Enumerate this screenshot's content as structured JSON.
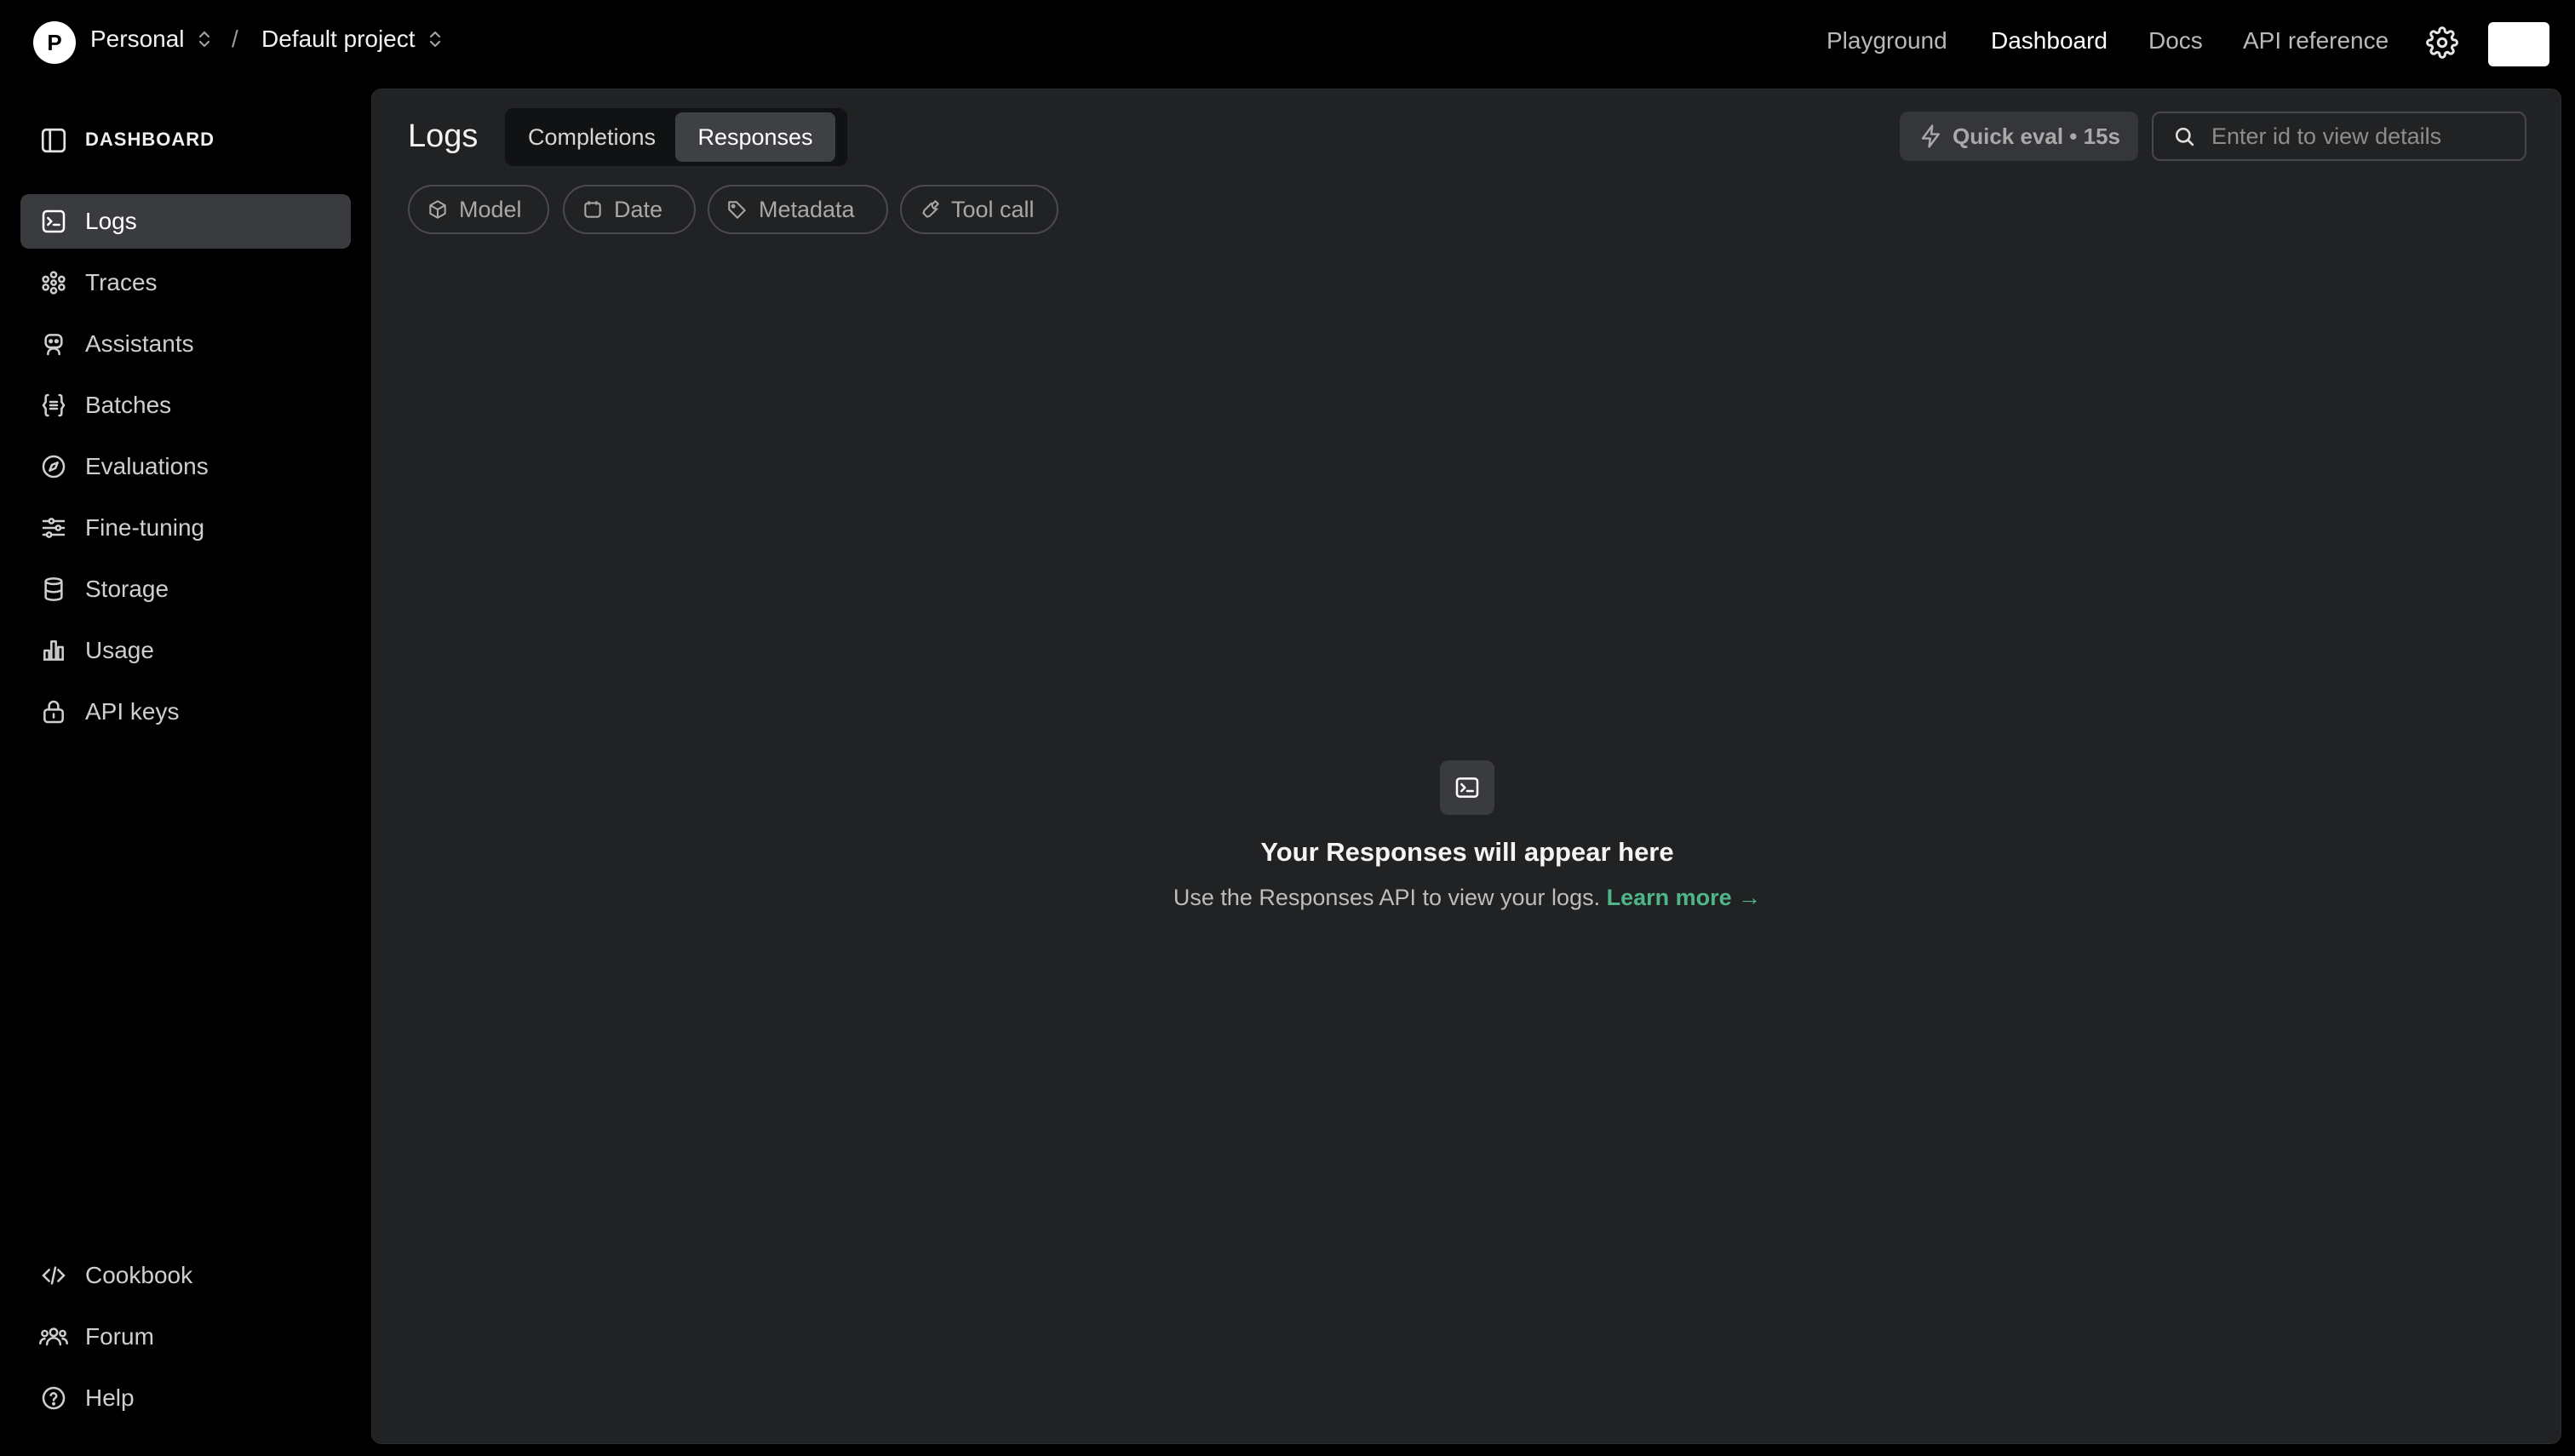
{
  "topbar": {
    "org_initial": "P",
    "org_name": "Personal",
    "separator": "/",
    "project_name": "Default project",
    "nav": [
      "Playground",
      "Dashboard",
      "Docs",
      "API reference"
    ],
    "active_nav": "Dashboard",
    "icons": {
      "settings": "gear-icon",
      "selector": "chevron-up-down-icon"
    }
  },
  "sidebar": {
    "heading": "DASHBOARD",
    "items": [
      {
        "label": "Logs",
        "icon": "terminal-icon",
        "active": true
      },
      {
        "label": "Traces",
        "icon": "traces-icon"
      },
      {
        "label": "Assistants",
        "icon": "robot-icon"
      },
      {
        "label": "Batches",
        "icon": "braces-list-icon"
      },
      {
        "label": "Evaluations",
        "icon": "compass-icon"
      },
      {
        "label": "Fine-tuning",
        "icon": "sliders-icon"
      },
      {
        "label": "Storage",
        "icon": "database-icon"
      },
      {
        "label": "Usage",
        "icon": "bar-chart-icon"
      },
      {
        "label": "API keys",
        "icon": "lock-icon"
      }
    ],
    "footer_items": [
      {
        "label": "Cookbook",
        "icon": "code-icon"
      },
      {
        "label": "Forum",
        "icon": "users-icon"
      },
      {
        "label": "Help",
        "icon": "help-icon"
      }
    ]
  },
  "main": {
    "title": "Logs",
    "tabs": [
      {
        "label": "Completions",
        "active": false
      },
      {
        "label": "Responses",
        "active": true
      }
    ],
    "quick_eval": "Quick eval • 15s",
    "search": {
      "placeholder": "Enter id to view details",
      "value": ""
    },
    "filters": [
      {
        "label": "Model",
        "icon": "cube-icon"
      },
      {
        "label": "Date",
        "icon": "calendar-icon"
      },
      {
        "label": "Metadata",
        "icon": "tag-icon"
      },
      {
        "label": "Tool call",
        "icon": "wrench-icon"
      }
    ],
    "empty_state": {
      "icon": "terminal-icon",
      "title": "Your Responses will appear here",
      "text": "Use the Responses API to view your logs.",
      "link": "Learn more →"
    }
  },
  "colors": {
    "background": "#000000",
    "panel": "#212224",
    "active_item": "#3a3b3f",
    "link": "#4fb68a"
  }
}
